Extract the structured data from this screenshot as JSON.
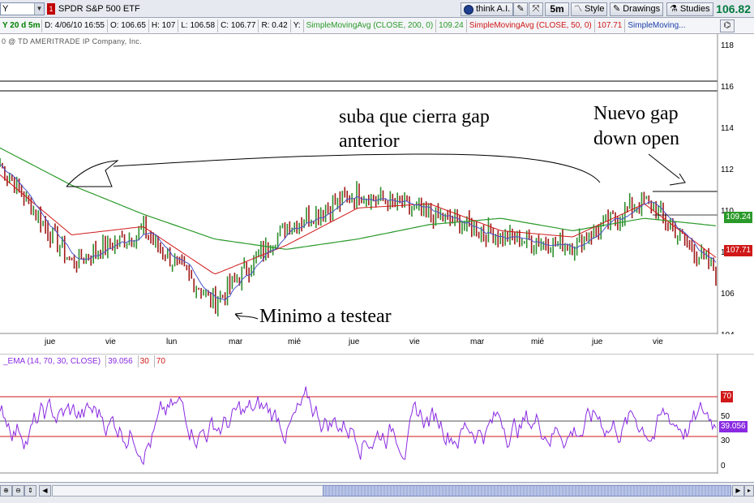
{
  "toolbar": {
    "symbol": "Y",
    "symbol_dropdown": "▼",
    "link_badge": "1",
    "security_name": "SPDR S&P 500 ETF",
    "think_ai_label": "think A.I.",
    "timeframe_label": "5m",
    "style_label": "Style",
    "drawings_label": "Drawings",
    "studies_label": "Studies",
    "last_price": "106.82",
    "last_price_color": "#007a3d"
  },
  "info_row": {
    "period": "Y 20 d 5m",
    "date": "D: 4/06/10 16:55",
    "open": "O: 106.65",
    "high": "H: 107",
    "low": "L: 106.58",
    "close": "C: 106.77",
    "range": "R: 0.42",
    "y": "Y:",
    "sma200_label": "SimpleMovingAvg (CLOSE, 200, 0)",
    "sma200_value": "109.24",
    "sma50_label": "SimpleMovingAvg (CLOSE, 50, 0)",
    "sma50_value": "107.71",
    "sma_more": "SimpleMoving...",
    "sma200_color": "#2a9a2a",
    "sma50_color": "#d01818"
  },
  "copyright": "0 @ TD AMERITRADE IP Company, Inc.",
  "annotations": {
    "gap_close": [
      "suba que cierra gap",
      "anterior"
    ],
    "new_gap": [
      "Nuevo gap",
      "down open"
    ],
    "minimum": "Minimo a testear"
  },
  "time_axis": [
    "jue",
    "vie",
    "lun",
    "mar",
    "mié",
    "jue",
    "vie",
    "mar",
    "mié",
    "jue",
    "vie"
  ],
  "price_axis": [
    "118",
    "116",
    "114",
    "112",
    "110",
    "108",
    "106",
    "104"
  ],
  "price_badges": {
    "sma200": "109.24",
    "sma50": "107.71"
  },
  "rsi": {
    "label": "_EMA (14, 70, 30, CLOSE)",
    "value": "39.056",
    "oversold": "30",
    "overbought": "70",
    "axis": [
      "70",
      "50",
      "30",
      "0"
    ],
    "color": "#8a2be2"
  },
  "scrollbar": {
    "left": "◀",
    "right": "▶"
  },
  "chart_data": {
    "type": "line",
    "title": "",
    "xlabel": "",
    "ylabel": "",
    "ylim": [
      104,
      118.5
    ],
    "x": [
      "jue",
      "vie",
      "lun",
      "mar",
      "mié",
      "jue",
      "vie",
      "mar",
      "mié",
      "jue",
      "vie"
    ],
    "series": [
      {
        "name": "price",
        "values": [
          112.2,
          107.5,
          109.0,
          105.5,
          109.2,
          110.8,
          109.8,
          108.7,
          108.3,
          110.5,
          107.0
        ]
      },
      {
        "name": "SimpleMovingAvg (CLOSE, 200, 0)",
        "values": [
          113.0,
          111.2,
          109.8,
          108.6,
          108.1,
          108.6,
          109.3,
          109.6,
          109.0,
          109.6,
          109.24
        ]
      },
      {
        "name": "SimpleMovingAvg (CLOSE, 50, 0)",
        "values": [
          111.7,
          108.8,
          109.2,
          106.9,
          108.3,
          110.1,
          110.3,
          109.0,
          108.7,
          110.3,
          107.71
        ]
      }
    ],
    "rsi_ylim": [
      0,
      100
    ],
    "rsi_lines": [
      30,
      50,
      70
    ]
  }
}
